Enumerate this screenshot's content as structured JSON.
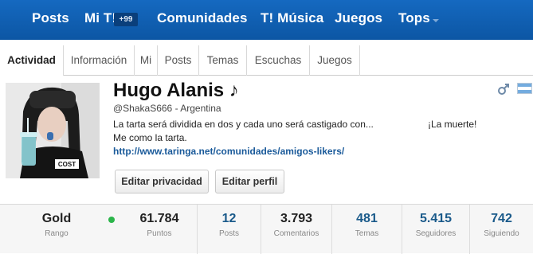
{
  "nav": {
    "items": [
      "Posts",
      "Mi T!",
      "Comunidades",
      "T! Música",
      "Juegos",
      "Tops"
    ],
    "badge": "+99"
  },
  "tabs": [
    "Actividad",
    "Información",
    "Mi",
    "Posts",
    "Temas",
    "Escuchas",
    "Juegos"
  ],
  "profile": {
    "name": "Hugo Alanis ♪",
    "handle": "@ShakaS666 - Argentina",
    "bio_line1": "La tarta será dividida en dos y cada uno será castigado con...",
    "bio_line1_end": "¡La muerte!",
    "bio_line2": "Me como la tarta.",
    "link": "http://www.taringa.net/comunidades/amigos-likers/",
    "avatar_shirt_text": "COST"
  },
  "buttons": {
    "privacy": "Editar privacidad",
    "profile": "Editar perfil"
  },
  "stats": [
    {
      "value": "Gold",
      "label": "Rango"
    },
    {
      "value": "61.784",
      "label": "Puntos"
    },
    {
      "value": "12",
      "label": "Posts"
    },
    {
      "value": "3.793",
      "label": "Comentarios"
    },
    {
      "value": "481",
      "label": "Temas"
    },
    {
      "value": "5.415",
      "label": "Seguidores"
    },
    {
      "value": "742",
      "label": "Siguiendo"
    }
  ],
  "colors": {
    "nav_bg": "#0f5fb0",
    "stat_link": "#1a5a8a",
    "status_online": "#2bb54a"
  }
}
